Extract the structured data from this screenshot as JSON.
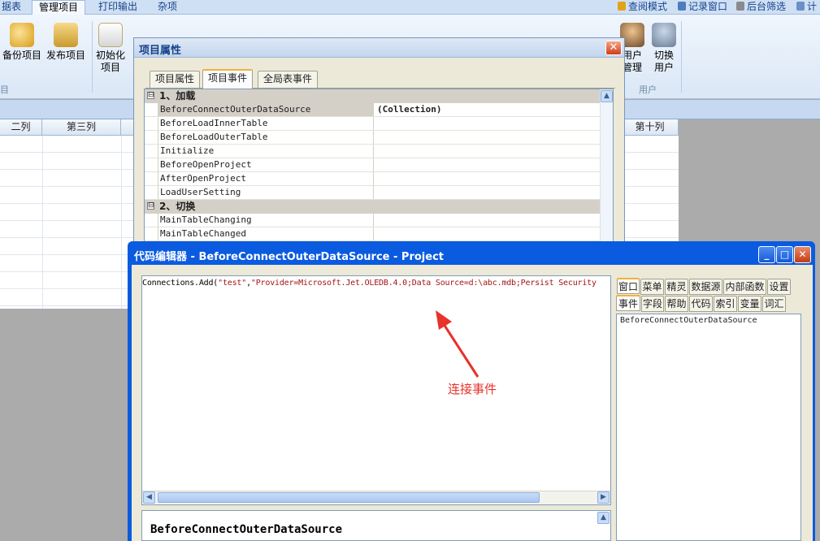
{
  "ribbon": {
    "tabs": [
      "据表",
      "管理项目",
      "打印输出",
      "杂项"
    ],
    "active_tab": "管理项目",
    "quick_access": [
      "查阅模式",
      "记录窗口",
      "后台筛选",
      "计"
    ],
    "buttons": [
      {
        "name": "backup",
        "label": "备份项目"
      },
      {
        "name": "publish",
        "label": "发布项目"
      },
      {
        "name": "init",
        "label1": "初始化",
        "label2": "项目"
      },
      {
        "name": "user-mgmt",
        "label1": "用户",
        "label2": "管理"
      },
      {
        "name": "switch-user",
        "label1": "切换",
        "label2": "用户"
      }
    ],
    "group_left": "目",
    "group_user": "用户"
  },
  "grid": {
    "columns": [
      "二列",
      "第三列",
      "第十列"
    ]
  },
  "prop_dialog": {
    "title": "项目属性",
    "close": "✕",
    "tabs": [
      "项目属性",
      "项目事件",
      "全局表事件"
    ],
    "active_tab": "项目事件",
    "categories": [
      {
        "toggle": "⊟",
        "label": "1、加载",
        "rows": [
          {
            "name": "BeforeConnectOuterDataSource",
            "value": "(Collection)",
            "selected": true
          },
          {
            "name": "BeforeLoadInnerTable",
            "value": ""
          },
          {
            "name": "BeforeLoadOuterTable",
            "value": ""
          },
          {
            "name": "Initialize",
            "value": ""
          },
          {
            "name": "BeforeOpenProject",
            "value": ""
          },
          {
            "name": "AfterOpenProject",
            "value": ""
          },
          {
            "name": "LoadUserSetting",
            "value": ""
          }
        ]
      },
      {
        "toggle": "⊟",
        "label": "2、切换",
        "rows": [
          {
            "name": "MainTableChanging",
            "value": ""
          },
          {
            "name": "MainTableChanged",
            "value": ""
          }
        ]
      }
    ]
  },
  "code_editor": {
    "title": "代码编辑器 - BeforeConnectOuterDataSource - Project",
    "window_buttons": {
      "minimize": "_",
      "maximize": "□",
      "close": "✕"
    },
    "code_prefix": "Connections.Add(",
    "code_arg1": "\"test\"",
    "code_comma": ",",
    "code_arg2": "\"Provider=Microsoft.Jet.OLEDB.4.0;Data Source=d:\\abc.mdb;Persist Security",
    "annotation": "连接事件",
    "bottom_text": "BeforeConnectOuterDataSource",
    "right_tabs_row1": [
      "窗口",
      "菜单",
      "精灵",
      "数据源",
      "内部函数",
      "设置"
    ],
    "right_tabs_row2": [
      "事件",
      "字段",
      "帮助",
      "代码",
      "索引",
      "变量",
      "词汇"
    ],
    "right_active_tab": "事件",
    "right_list": [
      "BeforeConnectOuterDataSource"
    ]
  },
  "colors": {
    "xp_title_blue": "#0a5bdf",
    "annotation_red": "#e8322a",
    "tab_accent": "#f3b13d"
  }
}
